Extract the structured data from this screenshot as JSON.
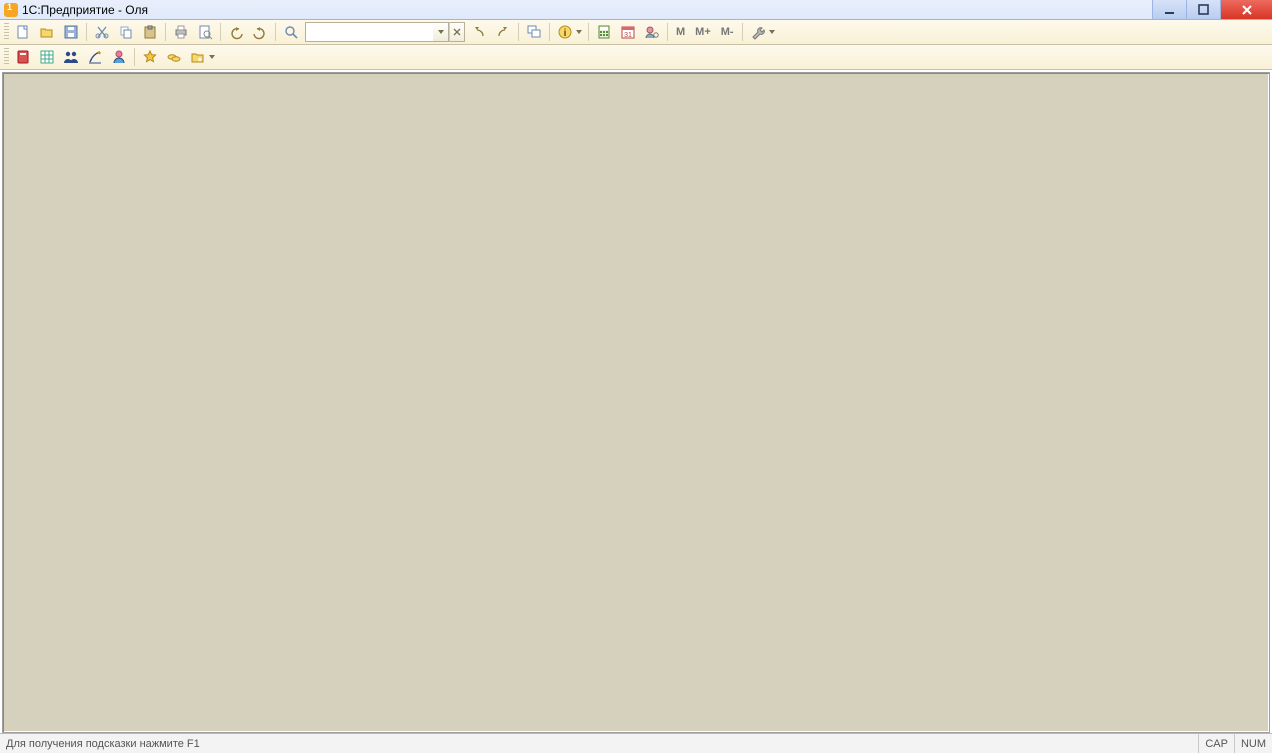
{
  "titlebar": {
    "title": "1С:Предприятие - Оля"
  },
  "toolbar1": {
    "search_value": "",
    "m_label": "M",
    "mplus_label": "M+",
    "mminus_label": "M-"
  },
  "statusbar": {
    "hint": "Для получения подсказки нажмите F1",
    "cap": "CAP",
    "num": "NUM"
  }
}
